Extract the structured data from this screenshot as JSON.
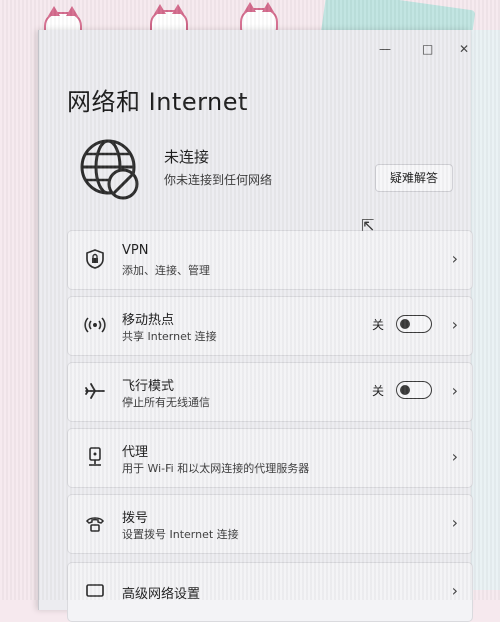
{
  "window": {
    "minimize_glyph": "—",
    "maximize_glyph": "□",
    "close_glyph": "✕"
  },
  "header": {
    "title": "网络和 Internet"
  },
  "status": {
    "title": "未连接",
    "subtitle": "你未连接到任何网络",
    "troubleshoot_label": "疑难解答"
  },
  "items": [
    {
      "title": "VPN",
      "subtitle": "添加、连接、管理",
      "icon": "shield-icon"
    },
    {
      "title": "移动热点",
      "subtitle": "共享 Internet 连接",
      "icon": "hotspot-icon",
      "toggle_label": "关",
      "toggle_on": false
    },
    {
      "title": "飞行模式",
      "subtitle": "停止所有无线通信",
      "icon": "airplane-icon",
      "toggle_label": "关",
      "toggle_on": false
    },
    {
      "title": "代理",
      "subtitle": "用于 Wi-Fi 和以太网连接的代理服务器",
      "icon": "proxy-icon"
    },
    {
      "title": "拨号",
      "subtitle": "设置拨号 Internet 连接",
      "icon": "dialup-icon"
    },
    {
      "title": "高级网络设置",
      "subtitle": "",
      "icon": "advanced-network-icon"
    }
  ],
  "chevron": "›"
}
